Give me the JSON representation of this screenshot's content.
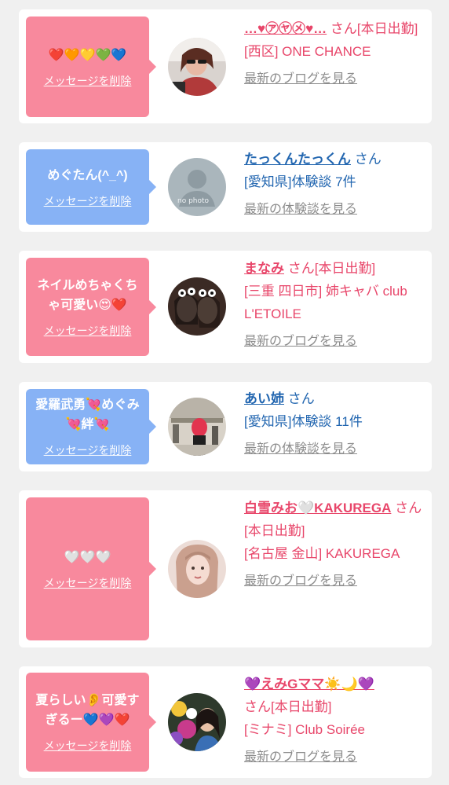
{
  "delete_label": "メッセージを削除",
  "colors": {
    "pink": "#f8899d",
    "blue": "#87b2f5",
    "name_pink": "#e8466a",
    "name_blue": "#2266b0",
    "link_gray": "#8c8c8c"
  },
  "items": [
    {
      "message": "❤️🧡💛💚💙",
      "name": "…♥㋐㋳㋱♥…",
      "suffix": "さん[本日出勤]",
      "location": "[西区] ONE CHANCE",
      "link": "最新のブログを見る"
    },
    {
      "message": "めぐたん(^_^)",
      "name": "たっくんたっくん",
      "suffix": "さん",
      "location": "[愛知県]体験談 7件",
      "link": "最新の体験談を見る",
      "avatar_text": "no photo"
    },
    {
      "message": "ネイルめちゃくちゃ可愛い😍❤️",
      "name": "まなみ",
      "suffix": "さん[本日出勤]",
      "location": "[三重 四日市] 姉キャバ club L'ETOILE",
      "link": "最新のブログを見る"
    },
    {
      "message": "愛羅武勇💘めぐみ💘絆💘",
      "name": "あい姉",
      "suffix": "さん",
      "location": "[愛知県]体験談 11件",
      "link": "最新の体験談を見る"
    },
    {
      "message": "🤍🤍🤍",
      "name": "白雪みお🤍KAKUREGA",
      "suffix": "さん[本日出勤]",
      "location": "[名古屋 金山] KAKUREGA",
      "link": "最新のブログを見る"
    },
    {
      "message": "夏らしい👂可愛すぎるー💙💜❤️",
      "name": "💜えみGママ☀️🌙💜",
      "suffix": "さん[本日出勤]",
      "location": "[ミナミ] Club Soirée",
      "link": "最新のブログを見る"
    }
  ]
}
